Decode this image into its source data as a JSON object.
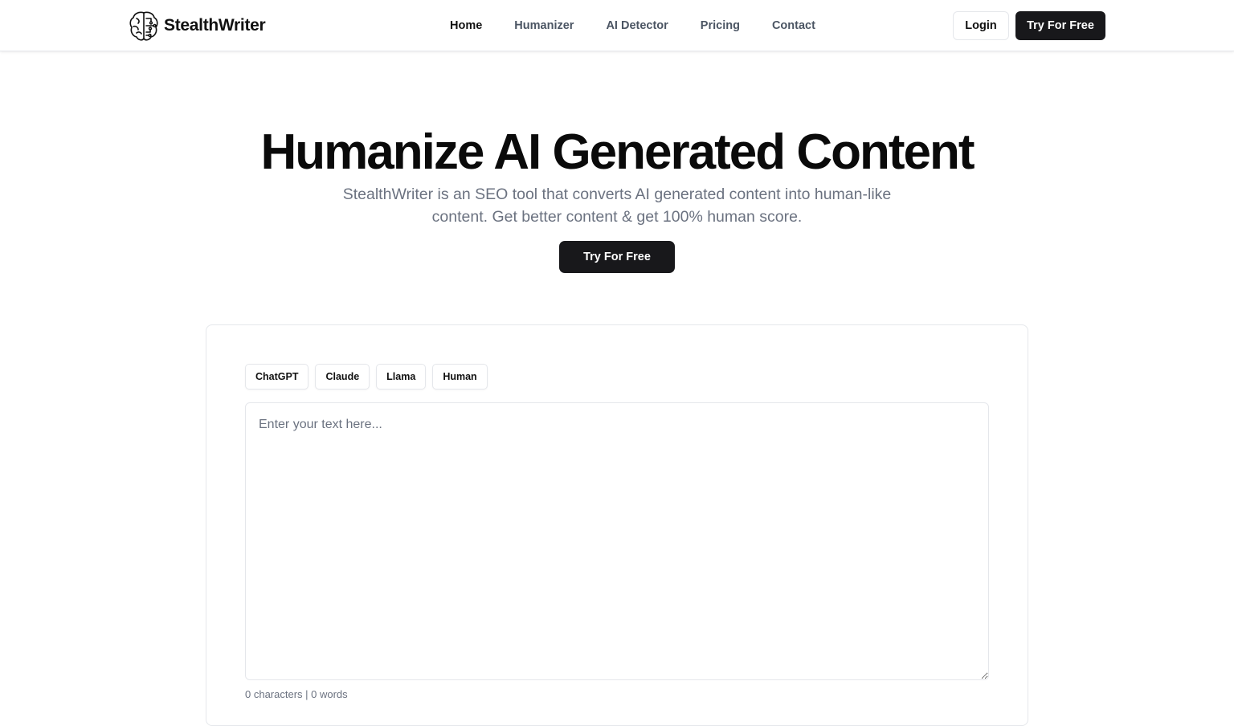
{
  "header": {
    "brand": "StealthWriter",
    "nav": [
      {
        "label": "Home",
        "active": true
      },
      {
        "label": "Humanizer",
        "active": false
      },
      {
        "label": "AI Detector",
        "active": false
      },
      {
        "label": "Pricing",
        "active": false
      },
      {
        "label": "Contact",
        "active": false
      }
    ],
    "login_label": "Login",
    "try_label": "Try For Free"
  },
  "hero": {
    "title": "Humanize AI Generated Content",
    "subtitle": "StealthWriter is an SEO tool that converts AI generated content into human-like content. Get better content & get 100% human score.",
    "cta_label": "Try For Free"
  },
  "editor": {
    "chips": [
      "ChatGPT",
      "Claude",
      "Llama",
      "Human"
    ],
    "placeholder": "Enter your text here...",
    "value": "",
    "counter": "0 characters | 0 words"
  },
  "colors": {
    "accent": "#18181b",
    "muted_text": "#6b7280",
    "border": "#e5e7eb"
  },
  "icons": {
    "logo": "brain-circuit-icon"
  }
}
